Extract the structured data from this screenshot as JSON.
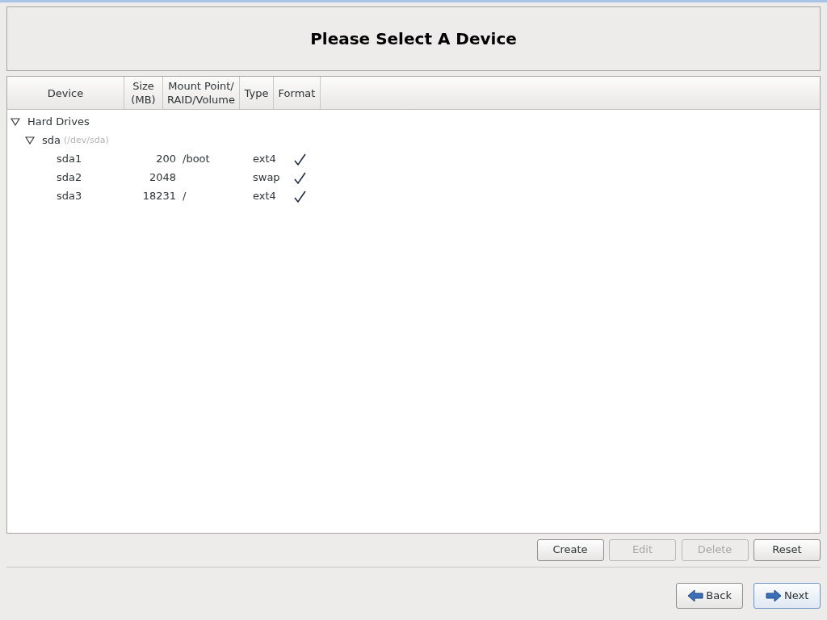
{
  "header": {
    "title": "Please Select A Device"
  },
  "table": {
    "columns": [
      {
        "label": "Device"
      },
      {
        "label": "Size\n(MB)"
      },
      {
        "label": "Mount Point/\nRAID/Volume"
      },
      {
        "label": "Type"
      },
      {
        "label": "Format"
      }
    ],
    "tree": [
      {
        "name": "Hard Drives",
        "expanded": true,
        "children": [
          {
            "name": "sda",
            "detail": "(/dev/sda)",
            "expanded": true,
            "children": [
              {
                "name": "sda1",
                "size": "200",
                "mount": "/boot",
                "type": "ext4",
                "format": true
              },
              {
                "name": "sda2",
                "size": "2048",
                "type": "swap",
                "format": true
              },
              {
                "name": "sda3",
                "size": "18231",
                "mount": "/",
                "type": "ext4",
                "format": true
              }
            ]
          }
        ]
      }
    ]
  },
  "actions": [
    {
      "label": "Create",
      "disabled": false
    },
    {
      "label": "Edit",
      "disabled": true
    },
    {
      "label": "Delete",
      "disabled": true
    },
    {
      "label": "Reset",
      "disabled": false
    }
  ],
  "navigation": [
    {
      "label": "Back",
      "kind": "back",
      "focused": false
    },
    {
      "label": "Next",
      "kind": "next",
      "focused": true
    }
  ]
}
